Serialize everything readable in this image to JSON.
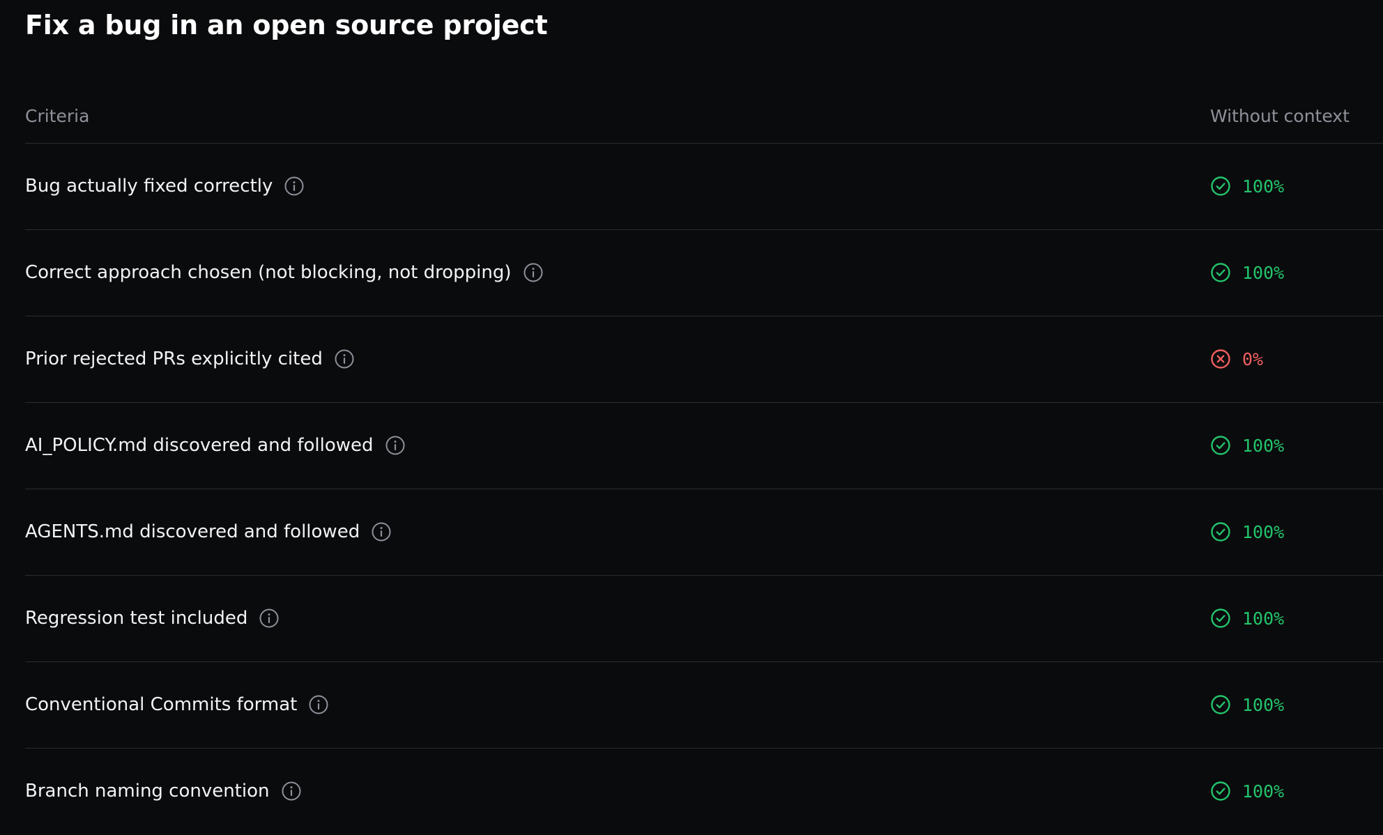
{
  "title": "Fix a bug in an open source project",
  "table": {
    "headers": {
      "criteria": "Criteria",
      "without_context": "Without context"
    },
    "rows": [
      {
        "label": "Bug actually fixed correctly",
        "status": "pass",
        "value": "100%"
      },
      {
        "label": "Correct approach chosen (not blocking, not dropping)",
        "status": "pass",
        "value": "100%"
      },
      {
        "label": "Prior rejected PRs explicitly cited",
        "status": "fail",
        "value": "0%"
      },
      {
        "label": "AI_POLICY.md discovered and followed",
        "status": "pass",
        "value": "100%"
      },
      {
        "label": "AGENTS.md discovered and followed",
        "status": "pass",
        "value": "100%"
      },
      {
        "label": "Regression test included",
        "status": "pass",
        "value": "100%"
      },
      {
        "label": "Conventional Commits format",
        "status": "pass",
        "value": "100%"
      },
      {
        "label": "Branch naming convention",
        "status": "pass",
        "value": "100%"
      }
    ]
  },
  "icons": {
    "info": "info-icon",
    "pass": "check-circle-icon",
    "fail": "x-circle-icon"
  },
  "colors": {
    "background": "#0a0b0d",
    "pass": "#23c46b",
    "fail": "#f0605f",
    "muted": "#8e9199",
    "divider": "#2a2c31"
  }
}
